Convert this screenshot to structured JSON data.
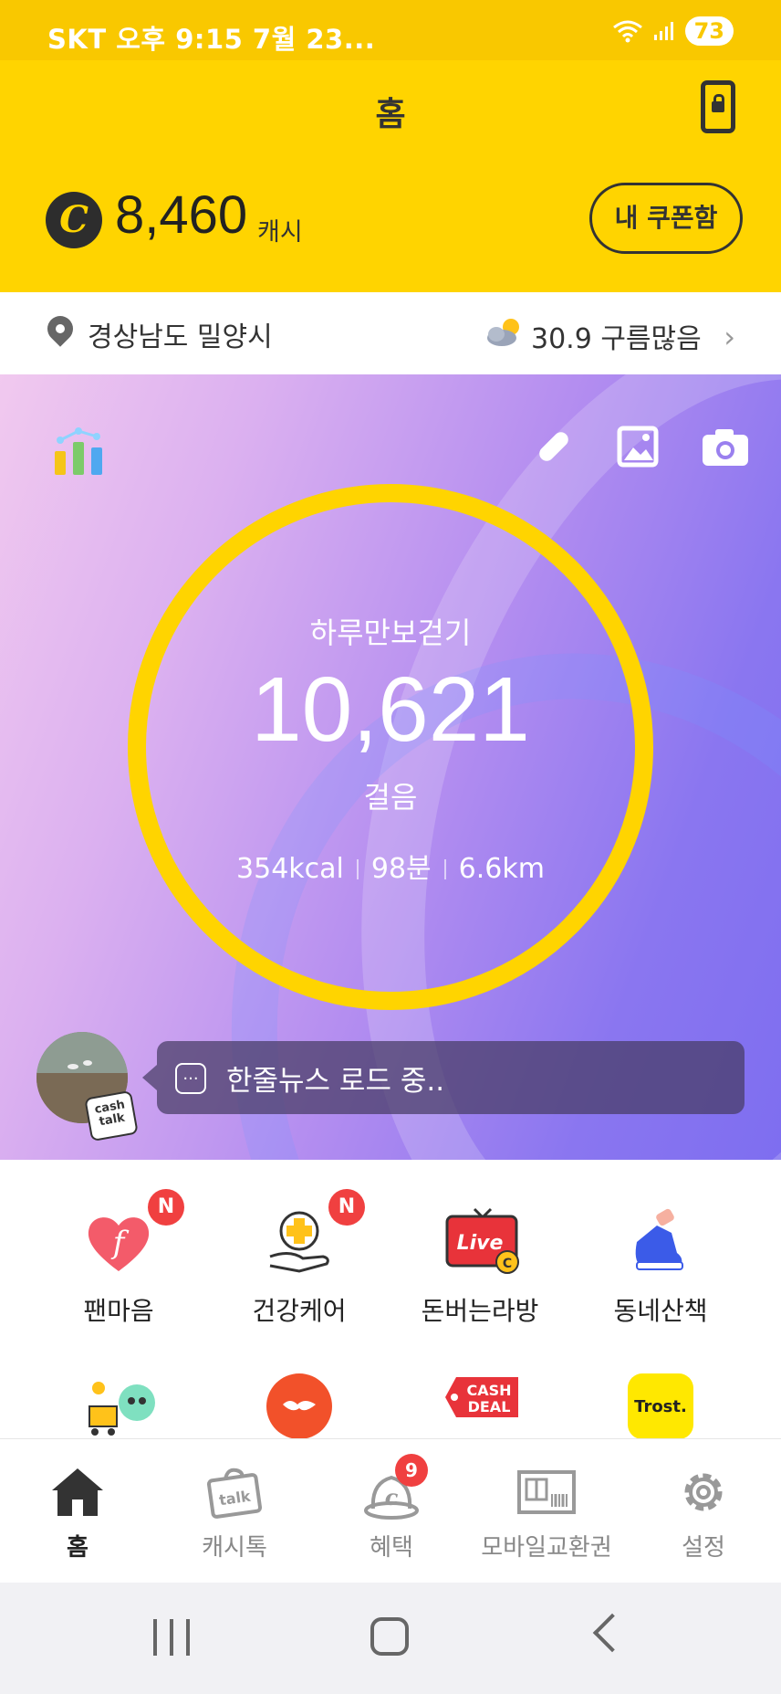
{
  "status_bar": {
    "left": "SKT 오후 9:15  7월 23...",
    "battery": "73"
  },
  "header": {
    "title": "홈"
  },
  "cash": {
    "amount": "8,460",
    "unit": "캐시",
    "coupon_label": "내 쿠폰함"
  },
  "location": {
    "place": "경상남도 밀양시",
    "weather": "30.9 구름많음"
  },
  "pedometer": {
    "label": "하루만보걷기",
    "steps": "10,621",
    "unit": "걸음",
    "kcal": "354kcal",
    "minutes": "98분",
    "distance": "6.6km"
  },
  "news": {
    "icon_text": "...",
    "text": "한줄뉴스 로드 중..",
    "badge_line1": "cash",
    "badge_line2": "talk"
  },
  "menu": [
    {
      "label": "팬마음",
      "badge": "N"
    },
    {
      "label": "건강케어",
      "badge": "N"
    },
    {
      "label": "돈버는라방"
    },
    {
      "label": "동네산책"
    }
  ],
  "menu_row2": {
    "cashdeal_line1": "CASH",
    "cashdeal_line2": "DEAL",
    "trost": "Trost."
  },
  "bottom_nav": [
    {
      "label": "홈",
      "active": true
    },
    {
      "label": "캐시톡"
    },
    {
      "label": "혜택",
      "badge": "9"
    },
    {
      "label": "모바일교환권"
    },
    {
      "label": "설정"
    }
  ],
  "colors": {
    "brand_yellow": "#FFD400",
    "badge_red": "#F04040"
  }
}
